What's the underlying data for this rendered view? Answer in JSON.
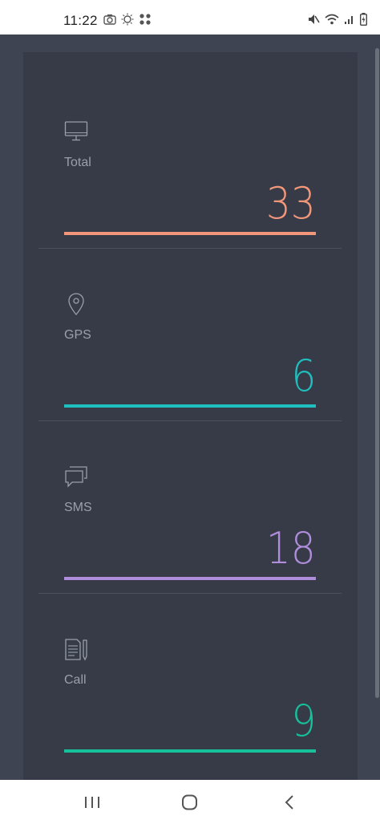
{
  "status_bar": {
    "time": "11:22"
  },
  "stats": [
    {
      "label": "Total",
      "value": "33",
      "icon": "monitor-icon",
      "color": "#f2977a"
    },
    {
      "label": "GPS",
      "value": "6",
      "icon": "location-pin-icon",
      "color": "#1fbfbf"
    },
    {
      "label": "SMS",
      "value": "18",
      "icon": "chat-bubbles-icon",
      "color": "#b08ddb"
    },
    {
      "label": "Call",
      "value": "9",
      "icon": "document-pen-icon",
      "color": "#16c09a"
    }
  ]
}
